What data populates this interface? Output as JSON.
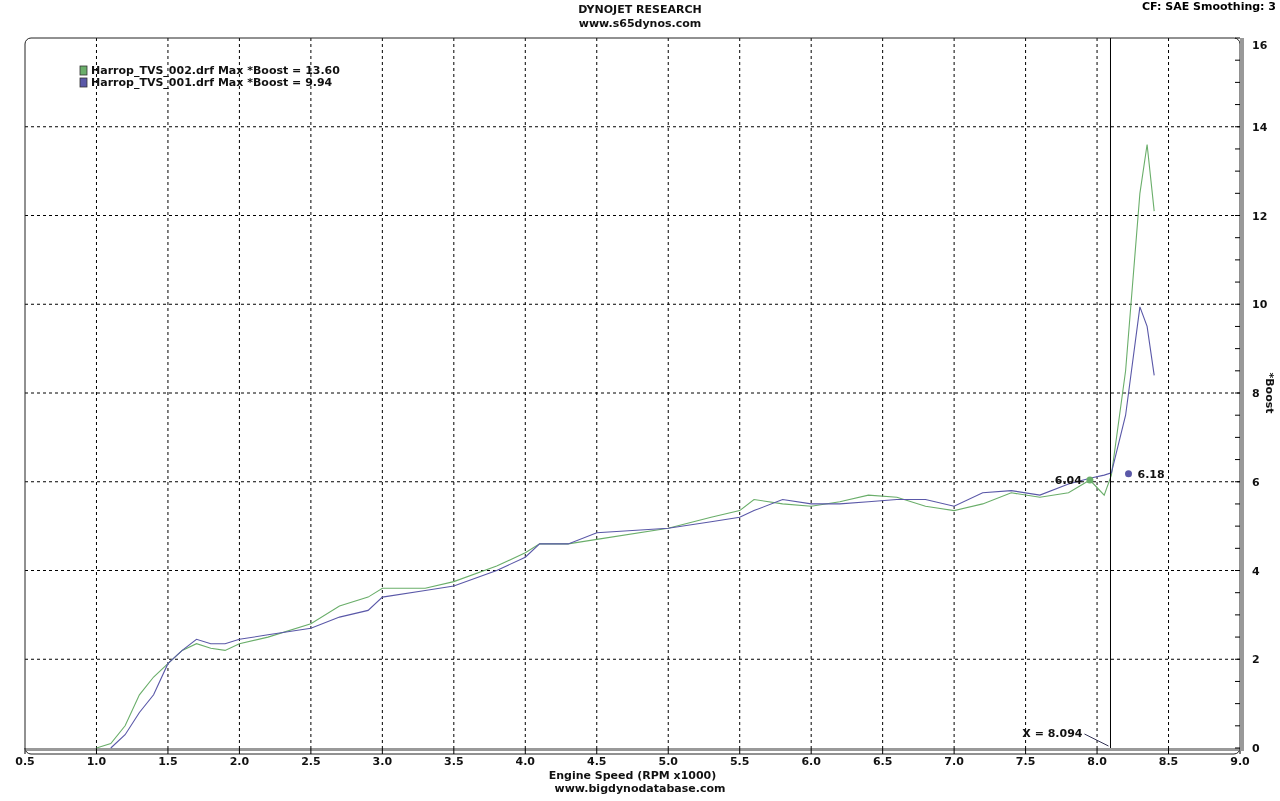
{
  "header": {
    "title": "DYNOJET RESEARCH",
    "subtitle": "www.s65dynos.com",
    "settings": "CF: SAE  Smoothing: 3"
  },
  "chart": {
    "chart_data": {
      "type": "line",
      "xlabel": "Engine Speed (RPM x1000)",
      "ylabel": "*Boost",
      "x": [
        1.0,
        1.1,
        1.2,
        1.3,
        1.4,
        1.5,
        1.6,
        1.7,
        1.8,
        1.9,
        2.0,
        2.2,
        2.5,
        2.7,
        2.9,
        3.0,
        3.3,
        3.5,
        3.8,
        4.0,
        4.1,
        4.3,
        4.5,
        5.0,
        5.3,
        5.5,
        5.6,
        5.8,
        6.0,
        6.2,
        6.4,
        6.6,
        6.8,
        7.0,
        7.2,
        7.4,
        7.6,
        7.8,
        7.95,
        8.05,
        8.1,
        8.2,
        8.3,
        8.35,
        8.4
      ],
      "series": [
        {
          "name": "Harrop_TVS_002.drf Max *Boost = 13.60",
          "color": "#6aae6a",
          "values": [
            0,
            0.1,
            0.5,
            1.2,
            1.6,
            1.9,
            2.2,
            2.35,
            2.25,
            2.2,
            2.35,
            2.5,
            2.8,
            3.2,
            3.4,
            3.6,
            3.6,
            3.75,
            4.1,
            4.4,
            4.6,
            4.6,
            4.7,
            4.95,
            5.2,
            5.35,
            5.6,
            5.5,
            5.45,
            5.55,
            5.7,
            5.65,
            5.45,
            5.35,
            5.5,
            5.75,
            5.65,
            5.75,
            6.04,
            5.7,
            6.15,
            8.5,
            12.5,
            13.6,
            12.1
          ]
        },
        {
          "name": "Harrop_TVS_001.drf Max *Boost = 9.94",
          "color": "#5a58a8",
          "values": [
            null,
            0,
            0.3,
            0.8,
            1.2,
            1.9,
            2.2,
            2.45,
            2.35,
            2.35,
            2.45,
            2.55,
            2.7,
            2.95,
            3.1,
            3.4,
            3.55,
            3.65,
            4.0,
            4.3,
            4.6,
            4.6,
            4.85,
            4.95,
            5.1,
            5.2,
            5.35,
            5.6,
            5.5,
            5.5,
            5.55,
            5.6,
            5.6,
            5.45,
            5.75,
            5.8,
            5.7,
            5.95,
            6.08,
            6.15,
            6.2,
            7.5,
            9.94,
            9.5,
            8.4
          ]
        }
      ],
      "xlim": [
        0.5,
        9.0
      ],
      "ylim": [
        0,
        16
      ],
      "xticks": [
        {
          "value": 0.5,
          "label": "0.5"
        },
        {
          "value": 1,
          "label": "1.0"
        },
        {
          "value": 1.5,
          "label": "1.5"
        },
        {
          "value": 2,
          "label": "2.0"
        },
        {
          "value": 2.5,
          "label": "2.5"
        },
        {
          "value": 3,
          "label": "3.0"
        },
        {
          "value": 3.5,
          "label": "3.5"
        },
        {
          "value": 4,
          "label": "4.0"
        },
        {
          "value": 4.5,
          "label": "4.5"
        },
        {
          "value": 5,
          "label": "5.0"
        },
        {
          "value": 5.5,
          "label": "5.5"
        },
        {
          "value": 6,
          "label": "6.0"
        },
        {
          "value": 6.5,
          "label": "6.5"
        },
        {
          "value": 7,
          "label": "7.0"
        },
        {
          "value": 7.5,
          "label": "7.5"
        },
        {
          "value": 8,
          "label": "8.0"
        },
        {
          "value": 8.5,
          "label": "8.5"
        },
        {
          "value": 9,
          "label": "9.0"
        }
      ],
      "yticks": [
        0,
        2,
        4,
        6,
        8,
        10,
        12,
        14,
        16
      ],
      "grid": true,
      "legend": "upper left",
      "ref_lines": [
        {
          "axis": "x",
          "value": 8.094,
          "label": "X = 8.094"
        }
      ],
      "annotations": [
        {
          "text": "6.04",
          "x": 7.95,
          "y": 6.04
        },
        {
          "text": "6.18",
          "x": 8.22,
          "y": 6.18
        }
      ]
    }
  },
  "footer": {
    "text": "www.bigdynodatabase.com"
  }
}
